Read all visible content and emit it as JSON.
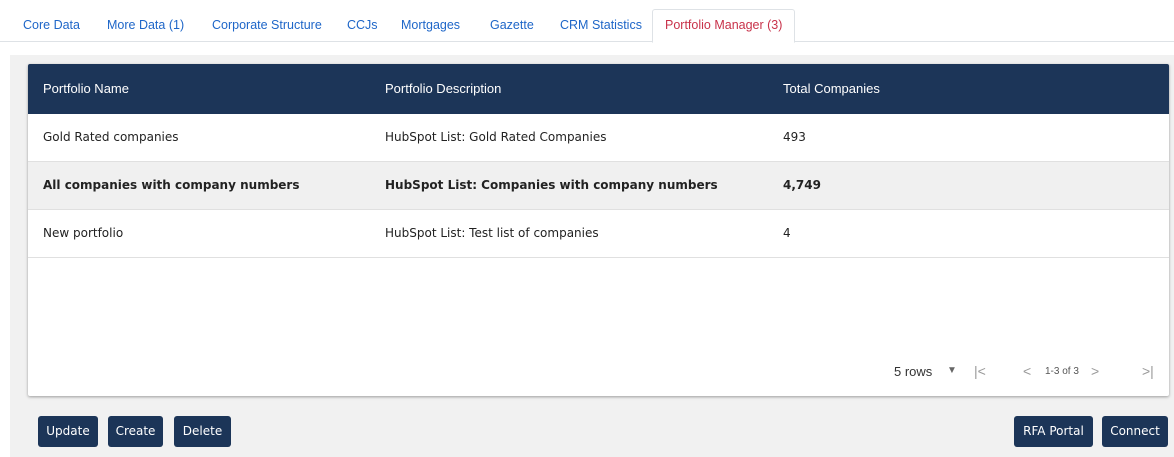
{
  "tabs": [
    {
      "label": "Core Data"
    },
    {
      "label": "More Data (1)"
    },
    {
      "label": "Corporate Structure"
    },
    {
      "label": "CCJs"
    },
    {
      "label": "Mortgages"
    },
    {
      "label": "Gazette"
    },
    {
      "label": "CRM Statistics"
    },
    {
      "label": "Portfolio Manager (3)"
    }
  ],
  "active_tab": "Portfolio Manager (3)",
  "table": {
    "columns": [
      "Portfolio Name",
      "Portfolio Description",
      "Total Companies"
    ],
    "rows": [
      {
        "name": "Gold Rated companies",
        "description": "HubSpot List: Gold Rated Companies",
        "total": "493",
        "selected": false
      },
      {
        "name": "All companies with company numbers",
        "description": "HubSpot List: Companies with company numbers",
        "total": "4,749",
        "selected": true
      },
      {
        "name": "New portfolio",
        "description": "HubSpot List: Test list of companies",
        "total": "4",
        "selected": false
      }
    ]
  },
  "pagination": {
    "rows_per_page": "5 rows",
    "range": "1-3 of 3"
  },
  "actions": {
    "update": "Update",
    "create": "Create",
    "delete": "Delete",
    "rfa_portal": "RFA Portal",
    "connect": "Connect"
  },
  "icons": {
    "rows_dropdown": "caret-down-icon",
    "first_page": "first-page-icon",
    "prev_page": "chevron-left-icon",
    "next_page": "chevron-right-icon",
    "last_page": "last-page-icon"
  },
  "colors": {
    "header_bg": "#1c3558",
    "tab_link": "#1e66c8",
    "tab_active": "#c8324a",
    "selected_row": "#f0f0f0"
  }
}
